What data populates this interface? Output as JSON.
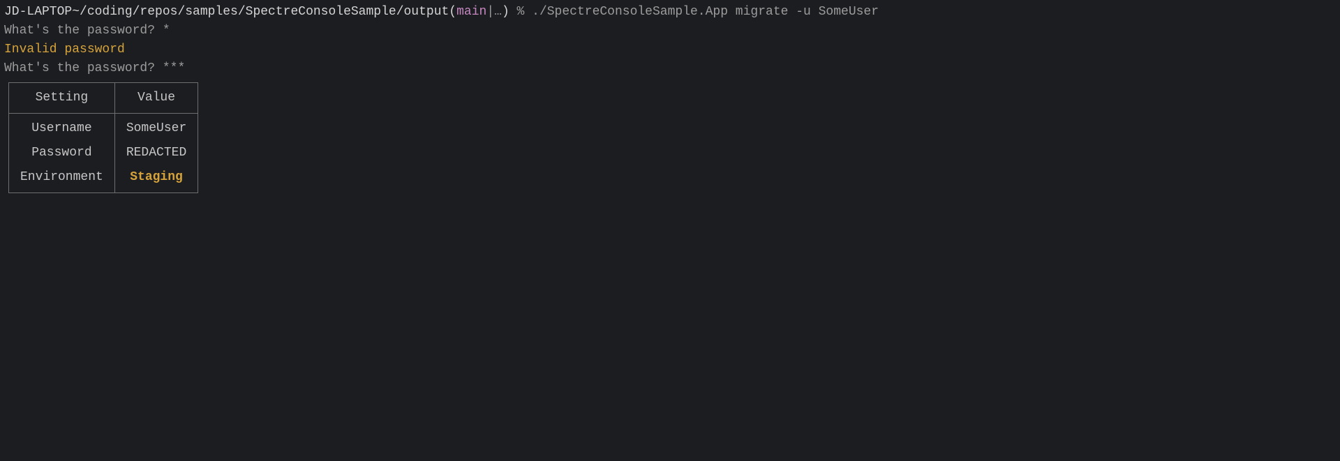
{
  "prompt": {
    "host_path": "JD-LAPTOP~/coding/repos/samples/SpectreConsoleSample/output(",
    "branch": "main",
    "branch_meta": "|…",
    "close_paren": ")",
    "percent": " % ",
    "command": "./SpectreConsoleSample.App migrate -u SomeUser"
  },
  "lines": {
    "q1": "What's the password? *",
    "error": "Invalid password",
    "q2": "What's the password? ***"
  },
  "table": {
    "headers": [
      "Setting",
      "Value"
    ],
    "rows": [
      {
        "setting": "Username",
        "value": "SomeUser",
        "accent": false
      },
      {
        "setting": "Password",
        "value": "REDACTED",
        "accent": false
      },
      {
        "setting": "Environment",
        "value": "Staging",
        "accent": true
      }
    ]
  }
}
